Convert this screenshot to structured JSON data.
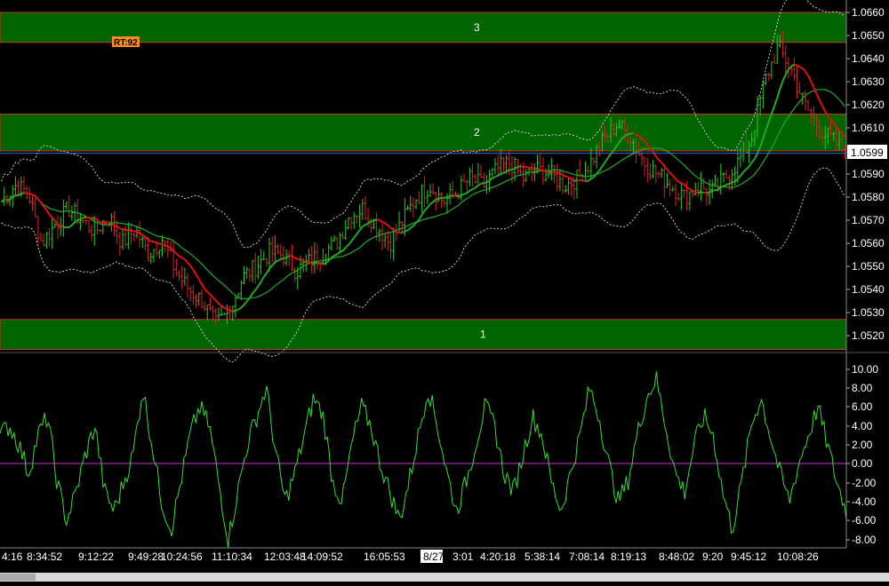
{
  "colors": {
    "background": "#000000",
    "zone_fill": "#006400",
    "zone_border": "#c0392b",
    "up_bar": "#22cc22",
    "down_bar": "#dd2222",
    "ma_red": "#e01010",
    "ma_green": "#22aa22",
    "band": "#cccccc",
    "current_price_line": "#2f6fd6",
    "oscillator": "#33dd33",
    "zero_line": "#cc33cc",
    "axis_text": "#ffffff",
    "rt_badge": "#ff8c1a"
  },
  "price_axis": {
    "labels": [
      "1.0660",
      "1.0650",
      "1.0640",
      "1.0630",
      "1.0620",
      "1.0610",
      "1.0590",
      "1.0580",
      "1.0570",
      "1.0560",
      "1.0550",
      "1.0540",
      "1.0530",
      "1.0520"
    ],
    "current_price": "1.0599"
  },
  "oscillator_axis": {
    "labels": [
      "10.00",
      "8.00",
      "6.00",
      "4.00",
      "2.00",
      "0.00",
      "-2.00",
      "-4.00",
      "-6.00",
      "-8.00"
    ]
  },
  "zones": [
    {
      "label": "3"
    },
    {
      "label": "2"
    },
    {
      "label": "1"
    }
  ],
  "rt_badge": "RT:92",
  "time_axis": {
    "labels": [
      "4:16",
      "8:34:52",
      "9:12:22",
      "9:49:28",
      "10:24:56",
      "11:10:34",
      "12:03:48",
      "14:09:52",
      "16:05:53",
      "8/27",
      "3:01",
      "4:20:18",
      "5:38:14",
      "7:08:14",
      "8:19:13",
      "8:48:02",
      "9:20",
      "9:45:12",
      "10:08:26"
    ]
  },
  "chart_data": [
    {
      "type": "candlestick",
      "ylim": [
        1.0512,
        1.0662
      ],
      "close_series_approx": [
        1.0578,
        1.0585,
        1.0582,
        1.056,
        1.0568,
        1.0575,
        1.057,
        1.0565,
        1.0572,
        1.056,
        1.0566,
        1.0555,
        1.0562,
        1.0548,
        1.054,
        1.0535,
        1.0525,
        1.053,
        1.0545,
        1.055,
        1.0556,
        1.0555,
        1.0548,
        1.0552,
        1.0556,
        1.056,
        1.0572,
        1.0575,
        1.0568,
        1.056,
        1.057,
        1.058,
        1.0585,
        1.0578,
        1.0582,
        1.0588,
        1.0585,
        1.0592,
        1.0595,
        1.0588,
        1.0592,
        1.059,
        1.0585,
        1.0588,
        1.0595,
        1.0605,
        1.0612,
        1.0606,
        1.0595,
        1.059,
        1.0585,
        1.058,
        1.0585,
        1.0582,
        1.0588,
        1.0595,
        1.0605,
        1.063,
        1.0645,
        1.0635,
        1.062,
        1.061,
        1.0605,
        1.06
      ],
      "zones": [
        {
          "label": "3",
          "from": 1.0647,
          "to": 1.066
        },
        {
          "label": "2",
          "from": 1.06,
          "to": 1.0616
        },
        {
          "label": "1",
          "from": 1.0514,
          "to": 1.0527
        }
      ],
      "current_price": 1.0599
    },
    {
      "type": "line",
      "ylim": [
        -9,
        11
      ],
      "values_approx": [
        3,
        4,
        2,
        -1,
        3,
        5,
        -2,
        -6,
        -3,
        1,
        4,
        -3,
        -5,
        -2,
        1,
        8,
        2,
        -4,
        -7,
        -2,
        3,
        6,
        4,
        -2,
        -8,
        -3,
        2,
        5,
        8,
        1,
        -4,
        -1,
        3,
        7,
        5,
        -2,
        -4,
        2,
        6,
        4,
        0,
        -3,
        -6,
        -2,
        3,
        8,
        4,
        -1,
        -5,
        -2,
        2,
        6,
        4,
        -1,
        -3,
        1,
        5,
        3,
        -2,
        -5,
        -1,
        3,
        8,
        5,
        0,
        -4,
        -2,
        3,
        7,
        9,
        4,
        -1,
        -3,
        2,
        5,
        3,
        -3,
        -7,
        -2,
        4,
        7,
        3,
        -1,
        -4,
        0,
        3,
        6,
        2,
        -2,
        -5
      ]
    }
  ]
}
